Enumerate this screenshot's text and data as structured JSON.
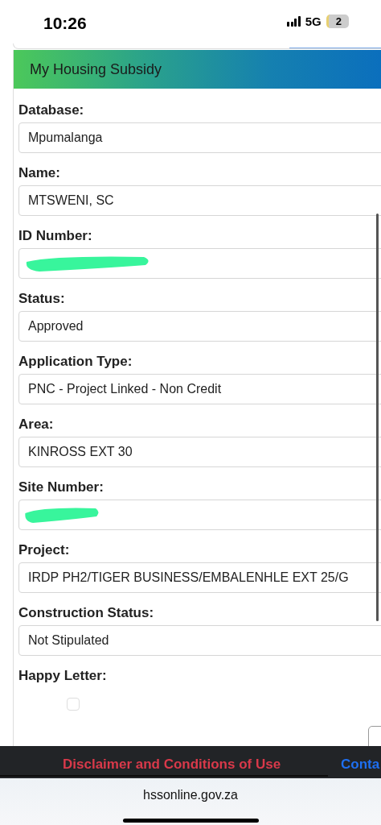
{
  "status_bar": {
    "time": "10:26",
    "network": "5G",
    "battery": "2"
  },
  "panel": {
    "title": "My Housing Subsidy"
  },
  "fields": [
    {
      "label": "Database:",
      "kind": "text",
      "value": "Mpumalanga"
    },
    {
      "label": "Name:",
      "kind": "text",
      "value": "MTSWENI, SC"
    },
    {
      "label": "ID Number:",
      "kind": "redacted"
    },
    {
      "label": "Status:",
      "kind": "text",
      "value": "Approved"
    },
    {
      "label": "Application Type:",
      "kind": "text",
      "value": "PNC - Project Linked - Non Credit"
    },
    {
      "label": "Area:",
      "kind": "text",
      "value": "KINROSS EXT 30"
    },
    {
      "label": "Site Number:",
      "kind": "redacted"
    },
    {
      "label": "Project:",
      "kind": "text",
      "value": "IRDP PH2/TIGER BUSINESS/EMBALENHLE EXT 25/G"
    },
    {
      "label": "Construction Status:",
      "kind": "text",
      "value": "Not Stipulated"
    },
    {
      "label": "Happy Letter:",
      "kind": "checkbox",
      "checked": false
    }
  ],
  "footer": {
    "links": [
      {
        "label": "Disclaimer and Conditions of Use",
        "color": "#d9394a"
      },
      {
        "label": "Conta",
        "color": "#1e6ff0"
      }
    ]
  },
  "address_bar": {
    "url": "hssonline.gov.za"
  }
}
